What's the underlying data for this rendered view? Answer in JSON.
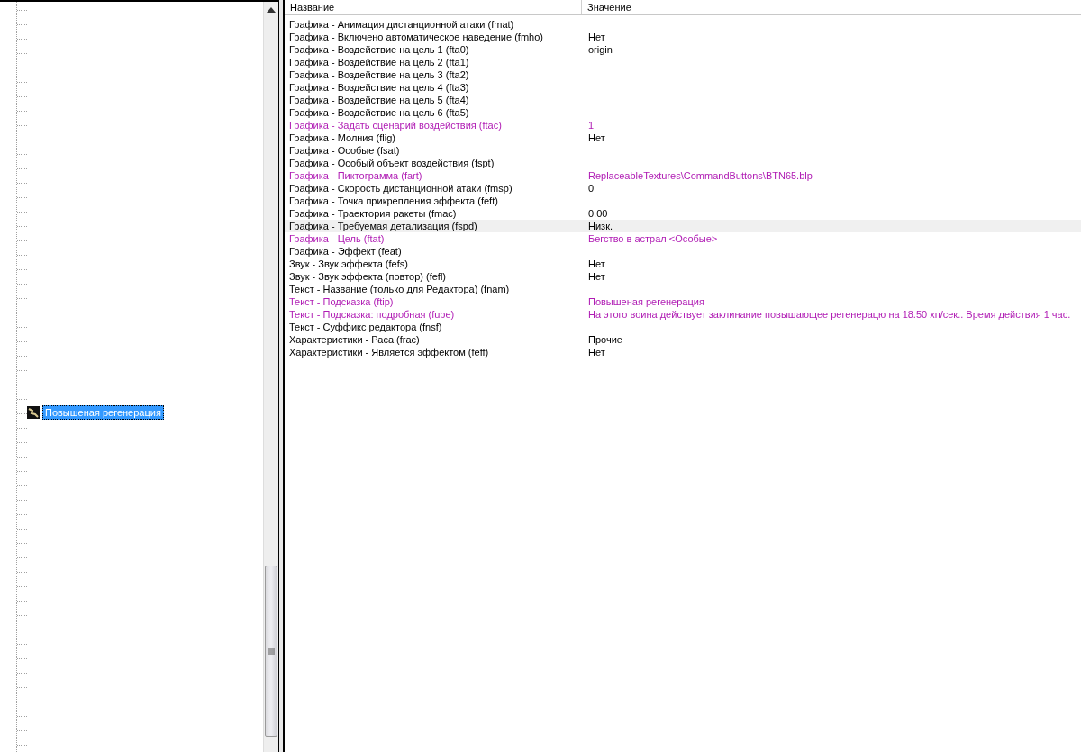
{
  "tree": {
    "items": [
      {
        "label": "Повышеная регенерация",
        "selected": true
      }
    ]
  },
  "properties": {
    "columns": [
      "Название",
      "Значение"
    ],
    "rows": [
      {
        "name": "Графика - Анимация дистанционной атаки (fmat)",
        "value": "",
        "modified": false,
        "highlighted": false
      },
      {
        "name": "Графика - Включено автоматическое наведение (fmho)",
        "value": "Нет",
        "modified": false,
        "highlighted": false
      },
      {
        "name": "Графика - Воздействие на цель 1 (fta0)",
        "value": "origin",
        "modified": false,
        "highlighted": false
      },
      {
        "name": "Графика - Воздействие на цель 2 (fta1)",
        "value": "",
        "modified": false,
        "highlighted": false
      },
      {
        "name": "Графика - Воздействие на цель 3 (fta2)",
        "value": "",
        "modified": false,
        "highlighted": false
      },
      {
        "name": "Графика - Воздействие на цель 4 (fta3)",
        "value": "",
        "modified": false,
        "highlighted": false
      },
      {
        "name": "Графика - Воздействие на цель 5 (fta4)",
        "value": "",
        "modified": false,
        "highlighted": false
      },
      {
        "name": "Графика - Воздействие на цель 6 (fta5)",
        "value": "",
        "modified": false,
        "highlighted": false
      },
      {
        "name": "Графика - Задать сценарий воздействия (ftac)",
        "value": "1",
        "modified": true,
        "highlighted": false
      },
      {
        "name": "Графика - Молния (flig)",
        "value": "Нет",
        "modified": false,
        "highlighted": false
      },
      {
        "name": "Графика - Особые (fsat)",
        "value": "",
        "modified": false,
        "highlighted": false
      },
      {
        "name": "Графика - Особый объект воздействия (fspt)",
        "value": "",
        "modified": false,
        "highlighted": false
      },
      {
        "name": "Графика - Пиктограмма (fart)",
        "value": "ReplaceableTextures\\CommandButtons\\BTN65.blp",
        "modified": true,
        "highlighted": false
      },
      {
        "name": "Графика - Скорость дистанционной атаки (fmsp)",
        "value": "0",
        "modified": false,
        "highlighted": false
      },
      {
        "name": "Графика - Точка прикрепления эффекта (feft)",
        "value": "",
        "modified": false,
        "highlighted": false
      },
      {
        "name": "Графика - Траектория ракеты (fmac)",
        "value": "0.00",
        "modified": false,
        "highlighted": false
      },
      {
        "name": "Графика - Требуемая детализация (fspd)",
        "value": "Низк.",
        "modified": false,
        "highlighted": true
      },
      {
        "name": "Графика - Цель (ftat)",
        "value": "Бегство в астрал <Особые>",
        "modified": true,
        "highlighted": false
      },
      {
        "name": "Графика - Эффект (feat)",
        "value": "",
        "modified": false,
        "highlighted": false
      },
      {
        "name": "Звук - Звук эффекта (fefs)",
        "value": "Нет",
        "modified": false,
        "highlighted": false
      },
      {
        "name": "Звук - Звук эффекта (повтор) (fefl)",
        "value": "Нет",
        "modified": false,
        "highlighted": false
      },
      {
        "name": "Текст - Название (только для Редактора) (fnam)",
        "value": "",
        "modified": false,
        "highlighted": false
      },
      {
        "name": "Текст - Подсказка (ftip)",
        "value": "Повышеная регенерация",
        "modified": true,
        "highlighted": false
      },
      {
        "name": "Текст - Подсказка: подробная (fube)",
        "value": "На этого воина действует заклинание повышающее регенерацю на 18.50 хп/сек.. Время действия 1 час.",
        "modified": true,
        "highlighted": false
      },
      {
        "name": "Текст - Суффикс редактора (fnsf)",
        "value": "",
        "modified": false,
        "highlighted": false
      },
      {
        "name": "Характеристики - Раса (frac)",
        "value": "Прочие",
        "modified": false,
        "highlighted": false
      },
      {
        "name": "Характеристики - Является эффектом (feff)",
        "value": "Нет",
        "modified": false,
        "highlighted": false
      }
    ]
  }
}
